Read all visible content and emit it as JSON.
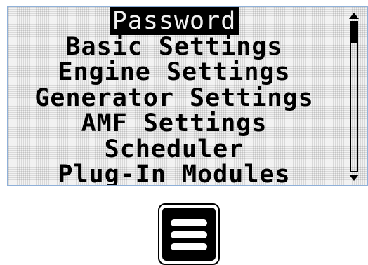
{
  "menu": {
    "items": [
      {
        "label": "Password",
        "selected": true
      },
      {
        "label": "Basic Settings",
        "selected": false
      },
      {
        "label": "Engine Settings",
        "selected": false
      },
      {
        "label": "Generator Settings",
        "selected": false
      },
      {
        "label": "AMF Settings",
        "selected": false
      },
      {
        "label": "Scheduler",
        "selected": false
      },
      {
        "label": "Plug-In Modules",
        "selected": false
      }
    ]
  },
  "scrollbar": {
    "thumb_start_fraction": 0.0,
    "thumb_size_fraction": 0.14
  },
  "controls": {
    "menu_button_icon": "hamburger-menu-icon"
  },
  "colors": {
    "screen_background": "#f2f2f2",
    "screen_border": "#8fb0d8",
    "text": "#000000",
    "selection_highlight": "#000000"
  }
}
